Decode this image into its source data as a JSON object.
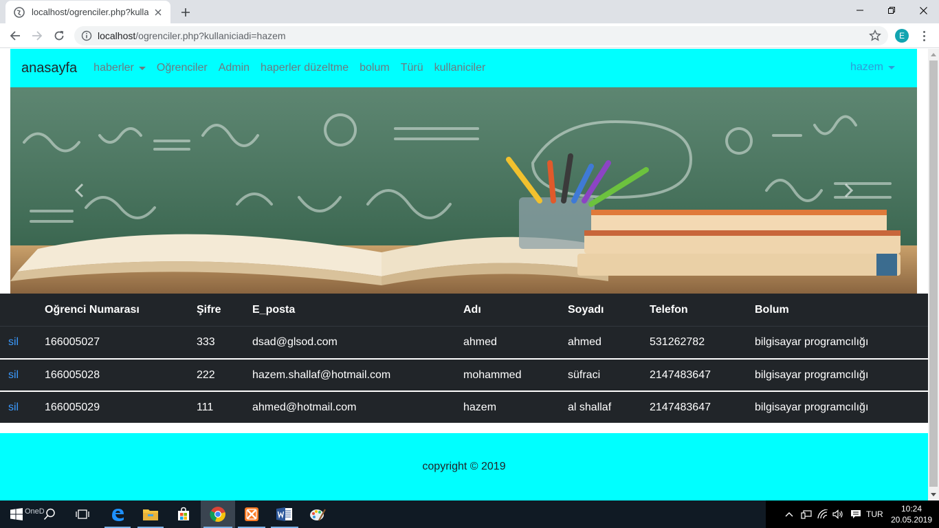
{
  "browser": {
    "tab_title": "localhost/ogrenciler.php?kullanic",
    "url_host": "localhost",
    "url_rest": "/ogrenciler.php?kullaniciadi=hazem",
    "profile_initial": "E"
  },
  "navbar": {
    "brand": "anasayfa",
    "links": [
      "haberler",
      "Oğrenciler",
      "Admin",
      "haperler düzeltme",
      "bolum",
      "Türü",
      "kullaniciler"
    ],
    "user": "hazem"
  },
  "table": {
    "headers": [
      "",
      "Oğrenci Numarası",
      "Şifre",
      "E_posta",
      "Adı",
      "Soyadı",
      "Telefon",
      "Bolum"
    ],
    "rows": [
      [
        "sil",
        "166005027",
        "333",
        "dsad@glsod.com",
        "ahmed",
        "ahmed",
        "531262782",
        "bilgisayar programcılığı"
      ],
      [
        "sil",
        "166005028",
        "222",
        "hazem.shallaf@hotmail.com",
        "mohammed",
        "süfraci",
        "2147483647",
        "bilgisayar programcılığı"
      ],
      [
        "sil",
        "166005029",
        "111",
        "ahmed@hotmail.com",
        "hazem",
        "al shallaf",
        "2147483647",
        "bilgisayar programcılığı"
      ]
    ]
  },
  "footer": {
    "text": "copyright © 2019"
  },
  "taskbar": {
    "onedrive_label": "OneD",
    "language": "TUR",
    "time": "10:24",
    "date": "20.05.2019"
  },
  "colors": {
    "accent": "#00ffff",
    "table_bg": "#212529",
    "link": "#3b9bff"
  }
}
